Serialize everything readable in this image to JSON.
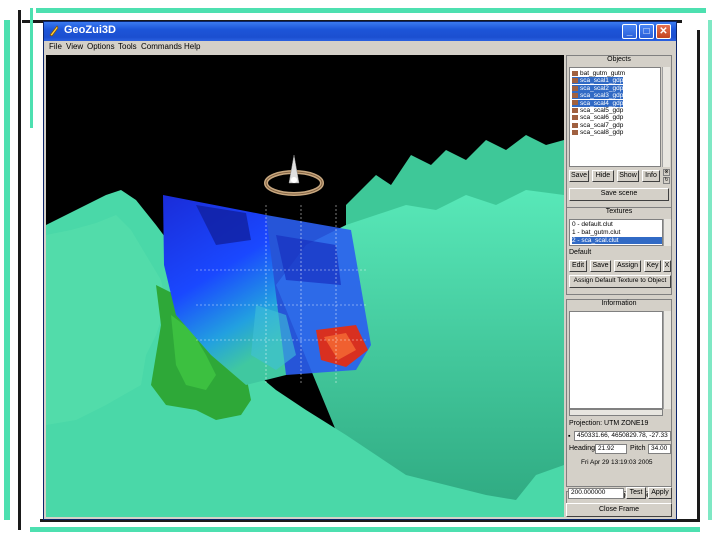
{
  "window": {
    "title": "GeoZui3D"
  },
  "menu": [
    "File",
    "View",
    "Options",
    "Tools",
    "Commands",
    "Help"
  ],
  "viewport": {
    "grid_label_left": "",
    "grid_label_right": ""
  },
  "objects": {
    "title": "Objects",
    "items": [
      {
        "label": "bat_gutm_gutm",
        "selected": false
      },
      {
        "label": "sca_scal1_gdp",
        "selected": true
      },
      {
        "label": "sca_scal2_gdp",
        "selected": true
      },
      {
        "label": "sca_scal3_gdp",
        "selected": true
      },
      {
        "label": "sca_scal4_gdp",
        "selected": true
      },
      {
        "label": "sca_scal5_gdp",
        "selected": false
      },
      {
        "label": "sca_scal6_gdp",
        "selected": false
      },
      {
        "label": "sca_scal7_gdp",
        "selected": false
      },
      {
        "label": "sca_scal8_gdp",
        "selected": false
      }
    ],
    "buttons": {
      "save": "Save",
      "hide": "Hide",
      "show": "Show",
      "info": "Info",
      "save_scene": "Save scene"
    }
  },
  "textures": {
    "title": "Textures",
    "items": [
      {
        "label": "0 - default.clut",
        "selected": false
      },
      {
        "label": "1 - bat_gutm.clut",
        "selected": false
      },
      {
        "label": "2 - sca_scal.clut",
        "selected": true
      }
    ],
    "current": "Default",
    "buttons": {
      "edit": "Edit",
      "save": "Save",
      "assign": "Assign",
      "key": "Key",
      "x": "X",
      "assign_default": "Assign Default Texture to Object"
    }
  },
  "information": {
    "title": "Information",
    "projection_label": "Projection:",
    "projection_value": "UTM ZONE19",
    "coords": "450331.66, 4650829.78, -27.33",
    "heading_label": "Heading",
    "heading_value": "21.92",
    "pitch_label": "Pitch",
    "pitch_value": "34.00",
    "datetime": "Fri Apr 29 13:19:03 2005"
  },
  "height": {
    "title": "Height Exaggeration",
    "value": "200.000000",
    "test": "Test",
    "apply": "Apply"
  },
  "close_frame": "Close Frame",
  "colors": {
    "title_bar": "#1c55d8",
    "selection": "#316ac5",
    "terrain": "#4de0b0",
    "terrain_green": "#2ea838",
    "volume_blue": "#1a3cff",
    "volume_red": "#e03020"
  }
}
